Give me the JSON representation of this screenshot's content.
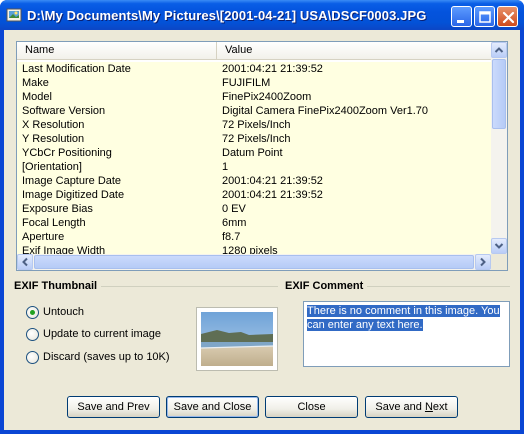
{
  "window": {
    "title": "D:\\My Documents\\My Pictures\\[2001-04-21] USA\\DSCF0003.JPG"
  },
  "list": {
    "columns": [
      "Name",
      "Value"
    ],
    "rows": [
      {
        "name": "Last Modification Date",
        "value": "2001:04:21 21:39:52"
      },
      {
        "name": "Make",
        "value": "FUJIFILM"
      },
      {
        "name": "Model",
        "value": "FinePix2400Zoom"
      },
      {
        "name": "Software Version",
        "value": "Digital Camera FinePix2400Zoom Ver1.70"
      },
      {
        "name": "X Resolution",
        "value": "72 Pixels/Inch"
      },
      {
        "name": "Y Resolution",
        "value": "72 Pixels/Inch"
      },
      {
        "name": "YCbCr Positioning",
        "value": "Datum Point"
      },
      {
        "name": "[Orientation]",
        "value": "1"
      },
      {
        "name": "Image Capture Date",
        "value": "2001:04:21 21:39:52"
      },
      {
        "name": "Image Digitized Date",
        "value": "2001:04:21 21:39:52"
      },
      {
        "name": "Exposure Bias",
        "value": "0 EV"
      },
      {
        "name": "Focal Length",
        "value": "6mm"
      },
      {
        "name": "Aperture",
        "value": "f8.7"
      },
      {
        "name": "Exif Image Width",
        "value": "1280 pixels"
      }
    ]
  },
  "thumbnail_group": {
    "title": "EXIF Thumbnail",
    "options": [
      {
        "label": "Untouch",
        "checked": true
      },
      {
        "label": "Update to current image",
        "checked": false
      },
      {
        "label": "Discard (saves up to 10K)",
        "checked": false
      }
    ]
  },
  "comment_group": {
    "title": "EXIF Comment",
    "text_line1": "There is no comment in this image. You",
    "text_line2": "can enter any text here."
  },
  "buttons": {
    "save_prev": "Save and Prev",
    "save_close": "Save and Close",
    "close": "Close",
    "save_next_prefix": "Save and ",
    "save_next_accel": "N",
    "save_next_suffix": "ext"
  },
  "colors": {
    "titlebar": "#0453dd",
    "list_bg": "#ffffe1",
    "selection": "#316ac5",
    "radio_dot": "#21a121"
  }
}
